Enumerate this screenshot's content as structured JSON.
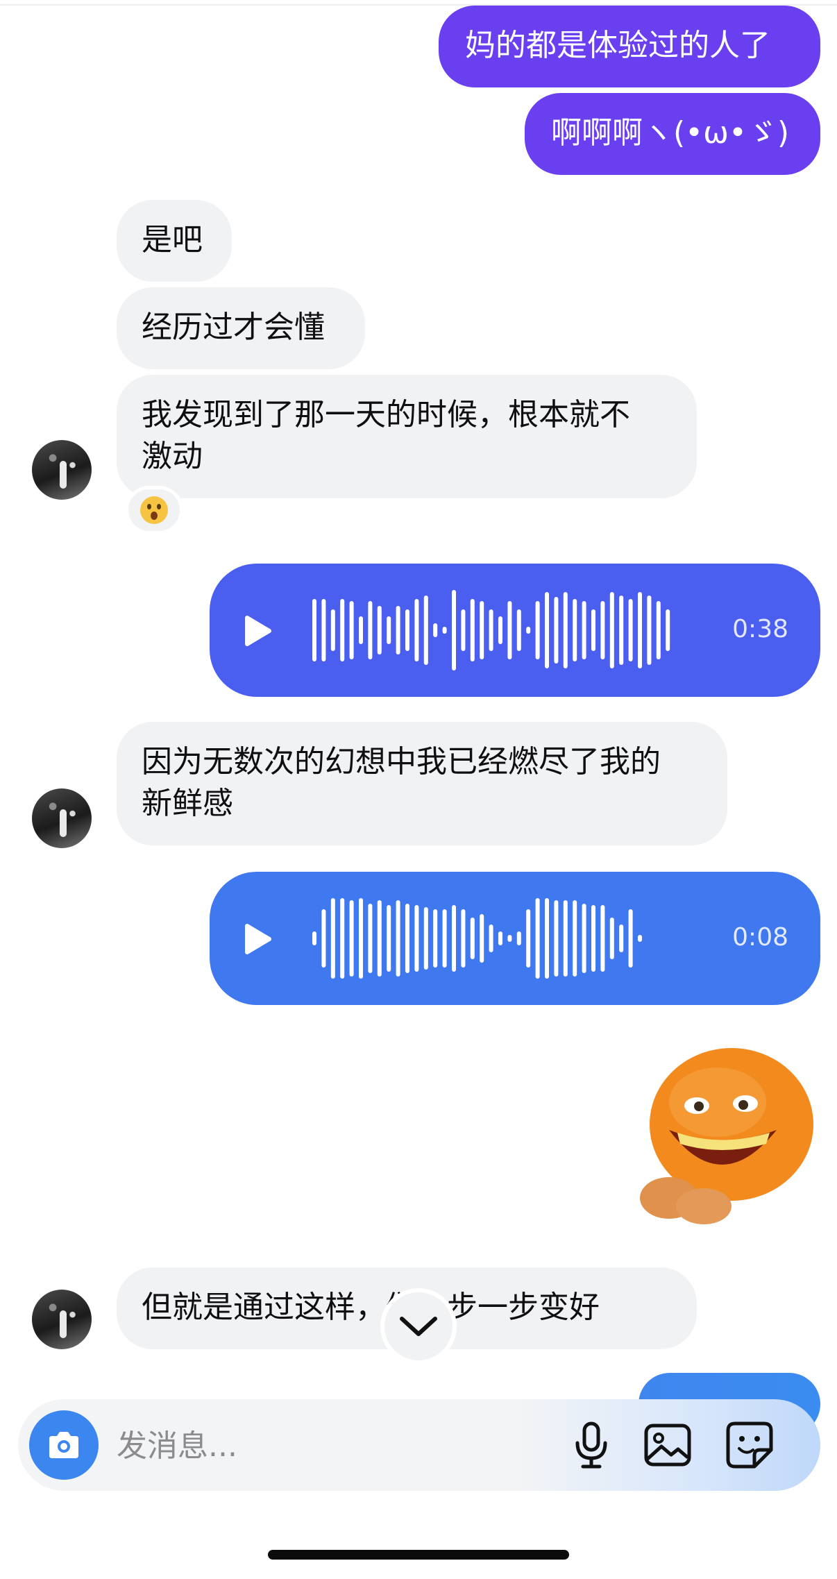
{
  "messages": {
    "out_1": "妈的都是体验过的人了",
    "out_2": "啊啊啊ヽ(•ω•ゞ)",
    "in_1": "是吧",
    "in_2": "经历过才会懂",
    "in_3_line1": "我发现到了那一天的时候，根本就不",
    "in_3_line2": "激动",
    "in_4_line1": "因为无数次的幻想中我已经燃尽了我的",
    "in_4_line2": "新鲜感",
    "in_5": "但就是通过这样，们一步一步变好"
  },
  "voice_messages": [
    {
      "duration": "0:38",
      "color": "#4a5ef0"
    },
    {
      "duration": "0:08",
      "color": "#3f78ef"
    }
  ],
  "composer": {
    "placeholder": "发消息..."
  },
  "colors": {
    "outgoing_top": "#6a3ff0",
    "outgoing_voice1": "#4a5ef0",
    "outgoing_voice2": "#3f78ef",
    "incoming_bg": "#f1f2f4",
    "camera": "#3c87ef"
  },
  "icons": {
    "reaction": "astonished-face-emoji",
    "sticker": "laughing-orange-sticker",
    "scroll": "chevron-down-icon",
    "camera": "camera-icon",
    "mic": "microphone-icon",
    "image": "image-icon",
    "sticker_btn": "sticker-icon"
  }
}
